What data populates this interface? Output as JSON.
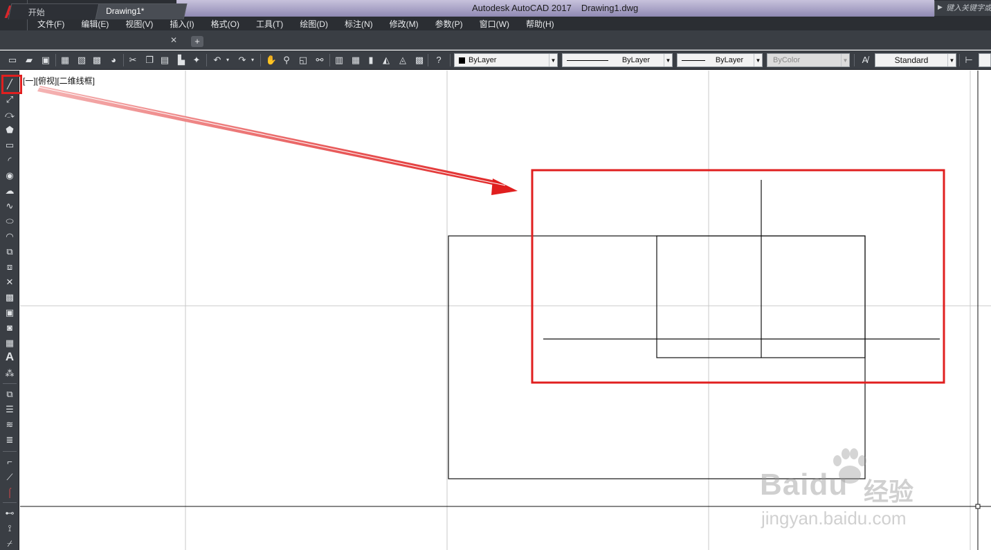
{
  "titlebar": {
    "app_name": "Autodesk AutoCAD 2017",
    "file_name": "Drawing1.dwg",
    "search_placeholder": "键入关键字或短语",
    "logo_glyph": "A"
  },
  "quick_access": {
    "icons": [
      "new-icon",
      "open-icon",
      "save-icon",
      "save-as-icon",
      "plot-icon",
      "undo-icon",
      "redo-icon",
      "customize-icon"
    ]
  },
  "menu": {
    "items": [
      "文件(F)",
      "编辑(E)",
      "视图(V)",
      "插入(I)",
      "格式(O)",
      "工具(T)",
      "绘图(D)",
      "标注(N)",
      "修改(M)",
      "参数(P)",
      "窗口(W)",
      "帮助(H)"
    ]
  },
  "tabs": {
    "start_label": "开始",
    "drawing_label": "Drawing1*",
    "close_glyph": "✕",
    "add_glyph": "+"
  },
  "properties": {
    "color": "ByLayer",
    "linetype": "ByLayer",
    "lineweight": "ByLayer",
    "plotstyle": "ByColor",
    "text_style": "Standard"
  },
  "canvas": {
    "viewport_label": "[一][俯视][二维线框]"
  },
  "watermark": {
    "brand": "Baidu",
    "sub": "经验",
    "url": "jingyan.baidu.com"
  },
  "colors": {
    "highlight_red": "#e01f1f",
    "panel_dark": "#2b2e33",
    "toolbar": "#3a3e44"
  }
}
